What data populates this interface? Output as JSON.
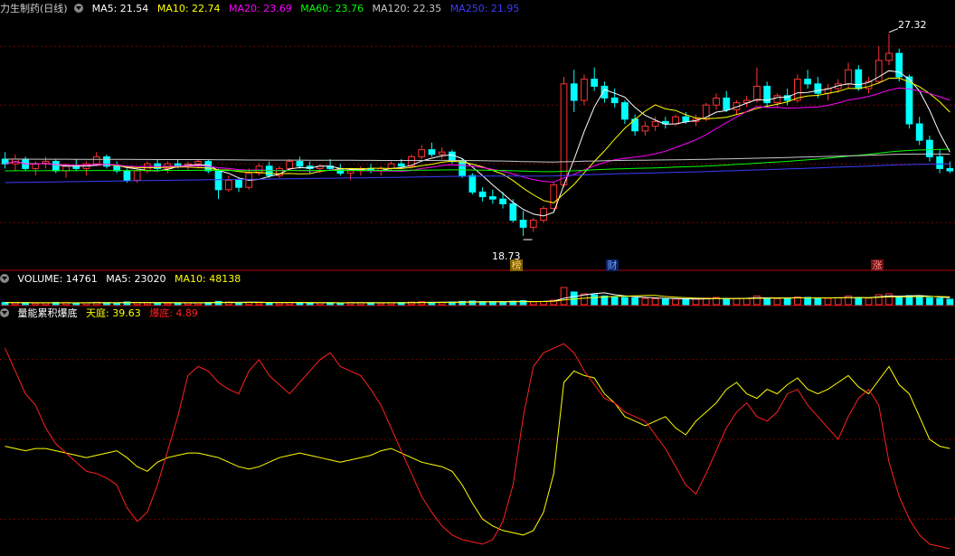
{
  "main_header": {
    "title": "力生制药(日线)",
    "ma5": "MA5: 21.54",
    "ma10": "MA10: 22.74",
    "ma20": "MA20: 23.69",
    "ma60": "MA60: 23.76",
    "ma120": "MA120: 22.35",
    "ma250": "MA250: 21.95"
  },
  "volume_header": {
    "volume": "VOLUME: 14761",
    "ma5": "MA5: 23020",
    "ma10": "MA10: 48138"
  },
  "indicator_header": {
    "name": "量能累积爆底",
    "tianting": "天庭: 39.63",
    "baodi": "爆底: 4.89"
  },
  "annotations": {
    "high": "27.32",
    "low": "18.73",
    "events": [
      "榜",
      "财",
      "涨"
    ]
  },
  "colors": {
    "up": "#ff3232",
    "down": "#00ffff",
    "ma5": "#ffffff",
    "ma10": "#ffff00",
    "ma20": "#ff00ff",
    "ma60": "#00ff00",
    "ma120": "#c8c8c8",
    "ma250": "#3c3cff",
    "tianting": "#ffff00",
    "baodi": "#ff2020",
    "grid": "#7a0000"
  },
  "chart_data": [
    {
      "type": "candlestick",
      "title": "力生制药(日线)",
      "y_range": [
        18.0,
        28.0
      ],
      "high_label": 27.32,
      "low_label": 18.73,
      "ohlc": [
        [
          22.0,
          22.3,
          21.6,
          21.8
        ],
        [
          21.8,
          22.2,
          21.5,
          22.0
        ],
        [
          22.0,
          22.1,
          21.5,
          21.6
        ],
        [
          21.6,
          21.9,
          21.3,
          21.8
        ],
        [
          21.8,
          22.1,
          21.6,
          21.9
        ],
        [
          21.9,
          22.0,
          21.4,
          21.5
        ],
        [
          21.5,
          21.8,
          21.2,
          21.7
        ],
        [
          21.7,
          22.0,
          21.5,
          21.6
        ],
        [
          21.6,
          21.9,
          21.3,
          21.8
        ],
        [
          21.8,
          22.3,
          21.7,
          22.1
        ],
        [
          22.1,
          22.2,
          21.6,
          21.7
        ],
        [
          21.7,
          21.9,
          21.4,
          21.5
        ],
        [
          21.5,
          21.6,
          21.0,
          21.1
        ],
        [
          21.1,
          21.6,
          21.0,
          21.5
        ],
        [
          21.5,
          21.9,
          21.4,
          21.8
        ],
        [
          21.8,
          22.0,
          21.5,
          21.6
        ],
        [
          21.6,
          21.9,
          21.4,
          21.8
        ],
        [
          21.8,
          22.0,
          21.6,
          21.7
        ],
        [
          21.7,
          21.9,
          21.5,
          21.8
        ],
        [
          21.8,
          22.0,
          21.6,
          21.9
        ],
        [
          21.9,
          22.0,
          21.4,
          21.5
        ],
        [
          21.5,
          21.6,
          20.3,
          20.7
        ],
        [
          20.7,
          21.3,
          20.6,
          21.1
        ],
        [
          21.1,
          21.2,
          20.6,
          20.8
        ],
        [
          20.8,
          21.6,
          20.7,
          21.4
        ],
        [
          21.4,
          21.8,
          21.3,
          21.7
        ],
        [
          21.7,
          21.9,
          21.2,
          21.3
        ],
        [
          21.3,
          21.7,
          21.2,
          21.6
        ],
        [
          21.6,
          22.0,
          21.5,
          21.9
        ],
        [
          21.9,
          22.1,
          21.6,
          21.7
        ],
        [
          21.7,
          21.9,
          21.4,
          21.6
        ],
        [
          21.6,
          21.8,
          21.4,
          21.7
        ],
        [
          21.7,
          22.0,
          21.5,
          21.6
        ],
        [
          21.6,
          21.8,
          21.3,
          21.4
        ],
        [
          21.4,
          21.6,
          21.1,
          21.5
        ],
        [
          21.5,
          21.7,
          21.3,
          21.6
        ],
        [
          21.6,
          21.8,
          21.4,
          21.5
        ],
        [
          21.5,
          21.7,
          21.3,
          21.6
        ],
        [
          21.6,
          21.9,
          21.5,
          21.8
        ],
        [
          21.8,
          22.0,
          21.6,
          21.7
        ],
        [
          21.7,
          22.2,
          21.6,
          22.1
        ],
        [
          22.1,
          22.6,
          22.0,
          22.4
        ],
        [
          22.4,
          22.7,
          22.1,
          22.2
        ],
        [
          22.2,
          22.5,
          22.0,
          22.3
        ],
        [
          22.3,
          22.4,
          21.8,
          21.9
        ],
        [
          21.9,
          22.0,
          21.2,
          21.3
        ],
        [
          21.3,
          21.4,
          20.5,
          20.6
        ],
        [
          20.6,
          20.8,
          20.2,
          20.4
        ],
        [
          20.4,
          20.7,
          20.1,
          20.3
        ],
        [
          20.3,
          20.6,
          19.9,
          20.1
        ],
        [
          20.1,
          20.3,
          19.3,
          19.4
        ],
        [
          19.4,
          19.8,
          18.73,
          19.1
        ],
        [
          19.1,
          19.5,
          18.9,
          19.4
        ],
        [
          19.4,
          20.0,
          19.3,
          19.9
        ],
        [
          19.9,
          21.0,
          19.8,
          20.9
        ],
        [
          20.9,
          25.5,
          20.8,
          25.2
        ],
        [
          25.2,
          25.8,
          24.0,
          24.5
        ],
        [
          24.5,
          25.6,
          24.3,
          25.4
        ],
        [
          25.4,
          25.9,
          24.9,
          25.1
        ],
        [
          25.1,
          25.3,
          24.4,
          24.6
        ],
        [
          24.6,
          25.0,
          24.2,
          24.4
        ],
        [
          24.4,
          24.5,
          23.5,
          23.7
        ],
        [
          23.7,
          23.9,
          23.0,
          23.2
        ],
        [
          23.2,
          23.6,
          23.0,
          23.4
        ],
        [
          23.4,
          23.8,
          23.2,
          23.6
        ],
        [
          23.6,
          23.8,
          23.3,
          23.5
        ],
        [
          23.5,
          23.9,
          23.4,
          23.8
        ],
        [
          23.8,
          24.0,
          23.5,
          23.6
        ],
        [
          23.6,
          23.9,
          23.4,
          23.7
        ],
        [
          23.7,
          24.4,
          23.6,
          24.3
        ],
        [
          24.3,
          24.8,
          24.1,
          24.6
        ],
        [
          24.6,
          24.9,
          24.0,
          24.1
        ],
        [
          24.1,
          24.5,
          23.9,
          24.4
        ],
        [
          24.4,
          24.7,
          24.2,
          24.5
        ],
        [
          24.5,
          25.9,
          24.4,
          25.1
        ],
        [
          25.1,
          25.3,
          24.2,
          24.4
        ],
        [
          24.4,
          24.8,
          24.2,
          24.7
        ],
        [
          24.7,
          25.0,
          24.3,
          24.5
        ],
        [
          24.5,
          25.6,
          24.4,
          25.4
        ],
        [
          25.4,
          25.8,
          25.0,
          25.2
        ],
        [
          25.2,
          25.5,
          24.6,
          24.8
        ],
        [
          24.8,
          25.2,
          24.5,
          25.0
        ],
        [
          25.0,
          25.4,
          24.8,
          25.2
        ],
        [
          25.2,
          26.1,
          25.0,
          25.8
        ],
        [
          25.8,
          26.0,
          24.9,
          25.0
        ],
        [
          25.0,
          25.5,
          24.8,
          25.3
        ],
        [
          25.3,
          26.8,
          25.2,
          26.2
        ],
        [
          26.2,
          27.32,
          26.0,
          26.5
        ],
        [
          26.5,
          26.7,
          25.3,
          25.5
        ],
        [
          25.5,
          25.6,
          23.3,
          23.5
        ],
        [
          23.5,
          23.8,
          22.6,
          22.8
        ],
        [
          22.8,
          23.0,
          21.9,
          22.1
        ],
        [
          22.1,
          22.4,
          21.4,
          21.6
        ],
        [
          21.6,
          21.9,
          21.4,
          21.5
        ]
      ],
      "ma_series": [
        "MA5",
        "MA10",
        "MA20",
        "MA60",
        "MA120",
        "MA250"
      ]
    },
    {
      "type": "bar",
      "title": "VOLUME",
      "values": [
        12,
        10,
        11,
        9,
        10,
        12,
        11,
        9,
        10,
        13,
        11,
        10,
        15,
        12,
        11,
        10,
        9,
        10,
        11,
        10,
        12,
        18,
        14,
        12,
        13,
        11,
        10,
        11,
        12,
        10,
        9,
        10,
        11,
        10,
        12,
        11,
        10,
        9,
        11,
        12,
        14,
        16,
        13,
        12,
        15,
        18,
        20,
        17,
        16,
        15,
        19,
        22,
        16,
        18,
        25,
        95,
        70,
        60,
        55,
        48,
        42,
        40,
        38,
        35,
        33,
        30,
        32,
        31,
        30,
        36,
        40,
        34,
        33,
        35,
        48,
        38,
        33,
        34,
        42,
        40,
        36,
        35,
        37,
        48,
        40,
        36,
        55,
        60,
        45,
        50,
        42,
        38,
        35,
        30
      ]
    },
    {
      "type": "line",
      "title": "量能累积爆底",
      "series": [
        {
          "name": "天庭",
          "values": [
            47,
            46,
            45,
            46,
            46,
            45,
            44,
            43,
            42,
            43,
            44,
            45,
            42,
            38,
            36,
            40,
            42,
            43,
            44,
            44,
            43,
            42,
            40,
            38,
            37,
            38,
            40,
            42,
            43,
            44,
            43,
            42,
            41,
            40,
            41,
            42,
            43,
            45,
            46,
            44,
            42,
            40,
            39,
            38,
            36,
            30,
            22,
            15,
            12,
            10,
            9,
            8,
            10,
            18,
            35,
            75,
            80,
            78,
            77,
            70,
            66,
            60,
            58,
            56,
            58,
            60,
            55,
            52,
            58,
            62,
            66,
            72,
            75,
            70,
            68,
            72,
            70,
            74,
            77,
            72,
            70,
            72,
            75,
            78,
            73,
            70,
            76,
            82,
            74,
            70,
            60,
            50,
            47,
            46
          ]
        },
        {
          "name": "爆底",
          "values": [
            90,
            80,
            70,
            65,
            55,
            48,
            44,
            40,
            36,
            35,
            33,
            30,
            20,
            14,
            18,
            30,
            45,
            60,
            78,
            82,
            80,
            75,
            72,
            70,
            80,
            85,
            78,
            74,
            70,
            75,
            80,
            85,
            88,
            82,
            80,
            78,
            72,
            65,
            55,
            45,
            35,
            25,
            18,
            12,
            8,
            6,
            5,
            4,
            6,
            14,
            30,
            60,
            82,
            88,
            90,
            92,
            88,
            80,
            74,
            68,
            66,
            62,
            60,
            58,
            52,
            46,
            38,
            30,
            26,
            35,
            45,
            55,
            62,
            66,
            60,
            58,
            62,
            70,
            72,
            65,
            60,
            55,
            50,
            60,
            68,
            72,
            65,
            40,
            25,
            15,
            8,
            4,
            3,
            2
          ]
        }
      ]
    }
  ]
}
